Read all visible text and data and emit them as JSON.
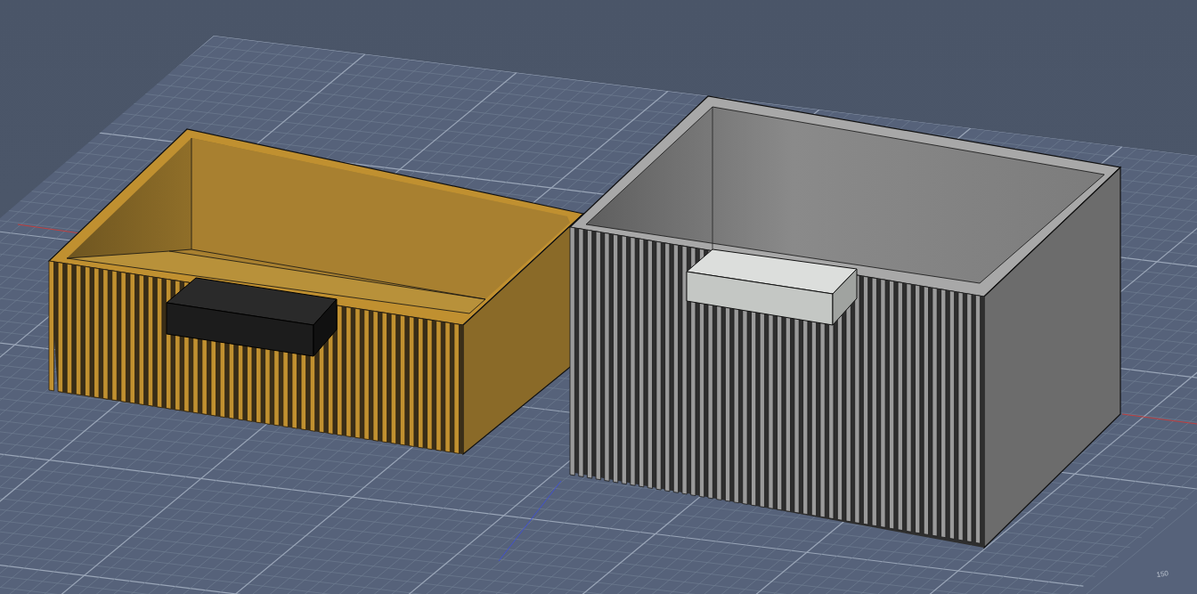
{
  "viewport": {
    "grid_label": "150"
  }
}
